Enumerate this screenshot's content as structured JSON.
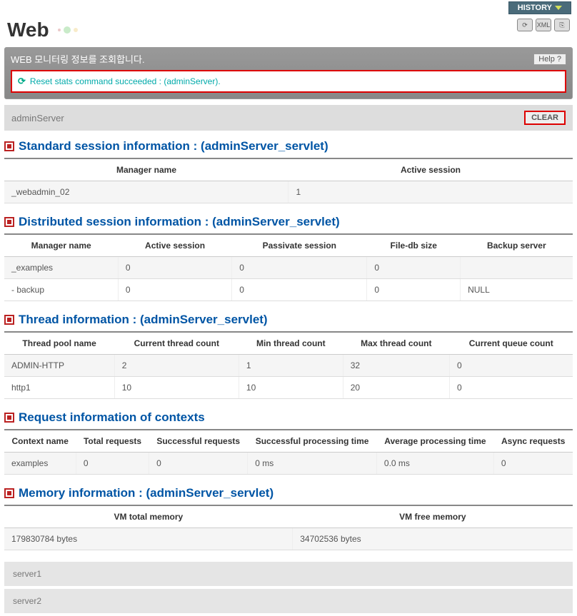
{
  "page_title": "Web",
  "history_label": "HISTORY",
  "banner": {
    "title": "WEB 모니터링 정보를 조회합니다.",
    "help_label": "Help",
    "status_message": "Reset stats command succeeded : (adminServer)."
  },
  "server_bar": {
    "name": "adminServer",
    "clear_label": "CLEAR"
  },
  "sections": {
    "standard_session": {
      "title": "Standard session information : (adminServer_servlet)",
      "headers": [
        "Manager name",
        "Active session"
      ],
      "rows": [
        {
          "manager": "_webadmin_02",
          "active": "1"
        }
      ]
    },
    "distributed_session": {
      "title": "Distributed session information : (adminServer_servlet)",
      "headers": [
        "Manager name",
        "Active session",
        "Passivate session",
        "File-db size",
        "Backup server"
      ],
      "rows": [
        {
          "c0": "_examples",
          "c1": "0",
          "c2": "0",
          "c3": "0",
          "c4": ""
        },
        {
          "c0": "- backup",
          "c1": "0",
          "c2": "0",
          "c3": "0",
          "c4": "NULL"
        }
      ]
    },
    "thread_info": {
      "title": "Thread information : (adminServer_servlet)",
      "headers": [
        "Thread pool name",
        "Current thread count",
        "Min thread count",
        "Max thread count",
        "Current queue count"
      ],
      "rows": [
        {
          "c0": "ADMIN-HTTP",
          "c1": "2",
          "c2": "1",
          "c3": "32",
          "c4": "0"
        },
        {
          "c0": "http1",
          "c1": "10",
          "c2": "10",
          "c3": "20",
          "c4": "0"
        }
      ]
    },
    "request_info": {
      "title": "Request information of contexts",
      "headers": [
        "Context name",
        "Total requests",
        "Successful requests",
        "Successful processing time",
        "Average processing time",
        "Async requests"
      ],
      "rows": [
        {
          "c0": "examples",
          "c1": "0",
          "c2": "0",
          "c3": "0 ms",
          "c4": "0.0 ms",
          "c5": "0"
        }
      ]
    },
    "memory_info": {
      "title": "Memory information : (adminServer_servlet)",
      "headers": [
        "VM total memory",
        "VM free memory"
      ],
      "rows": [
        {
          "c0": "179830784 bytes",
          "c1": "34702536 bytes"
        }
      ]
    }
  },
  "footer_servers": [
    "server1",
    "server2"
  ]
}
